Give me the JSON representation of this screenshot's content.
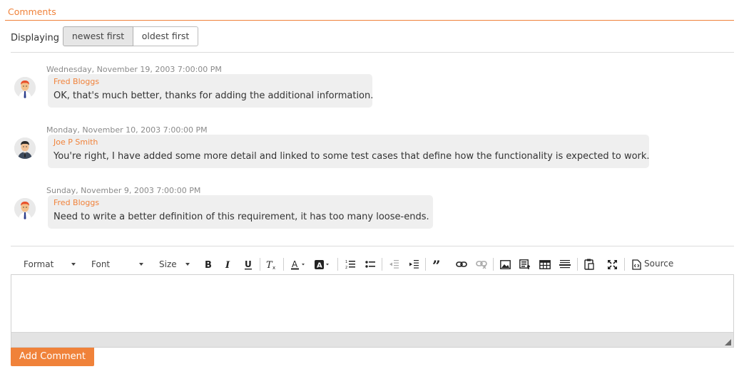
{
  "section": {
    "title": "Comments"
  },
  "sort": {
    "label": "Displaying",
    "newest": "newest first",
    "oldest": "oldest first",
    "selected": "newest first"
  },
  "comments": [
    {
      "date": "Wednesday, November 19, 2003 7:00:00 PM",
      "author": "Fred Bloggs",
      "text": "OK, that's much better, thanks for adding the additional information.",
      "avatar": "fred-avatar-icon"
    },
    {
      "date": "Monday, November 10, 2003 7:00:00 PM",
      "author": "Joe P Smith",
      "text": "You're right, I have added some more detail and linked to some test cases that define how the functionality is expected to work.",
      "avatar": "joe-avatar-icon"
    },
    {
      "date": "Sunday, November 9, 2003 7:00:00 PM",
      "author": "Fred Bloggs",
      "text": "Need to write a better definition of this requirement, it has too many loose-ends.",
      "avatar": "fred-avatar-icon"
    }
  ],
  "toolbar": {
    "format": "Format",
    "font": "Font",
    "size": "Size",
    "source": "Source",
    "icons": [
      "bold-icon",
      "italic-icon",
      "underline-icon",
      "remove-format-icon",
      "text-color-icon",
      "background-color-icon",
      "numbered-list-icon",
      "bulleted-list-icon",
      "decrease-indent-icon",
      "increase-indent-icon",
      "blockquote-icon",
      "link-icon",
      "unlink-icon",
      "image-icon",
      "image-gallery-icon",
      "table-icon",
      "horizontal-line-icon",
      "paste-icon",
      "maximize-icon",
      "source-icon"
    ]
  },
  "editor": {
    "value": ""
  },
  "actions": {
    "add_comment": "Add Comment"
  },
  "colors": {
    "accent": "#f0823a",
    "bubble": "#efefef",
    "date": "#8a8a8a"
  }
}
